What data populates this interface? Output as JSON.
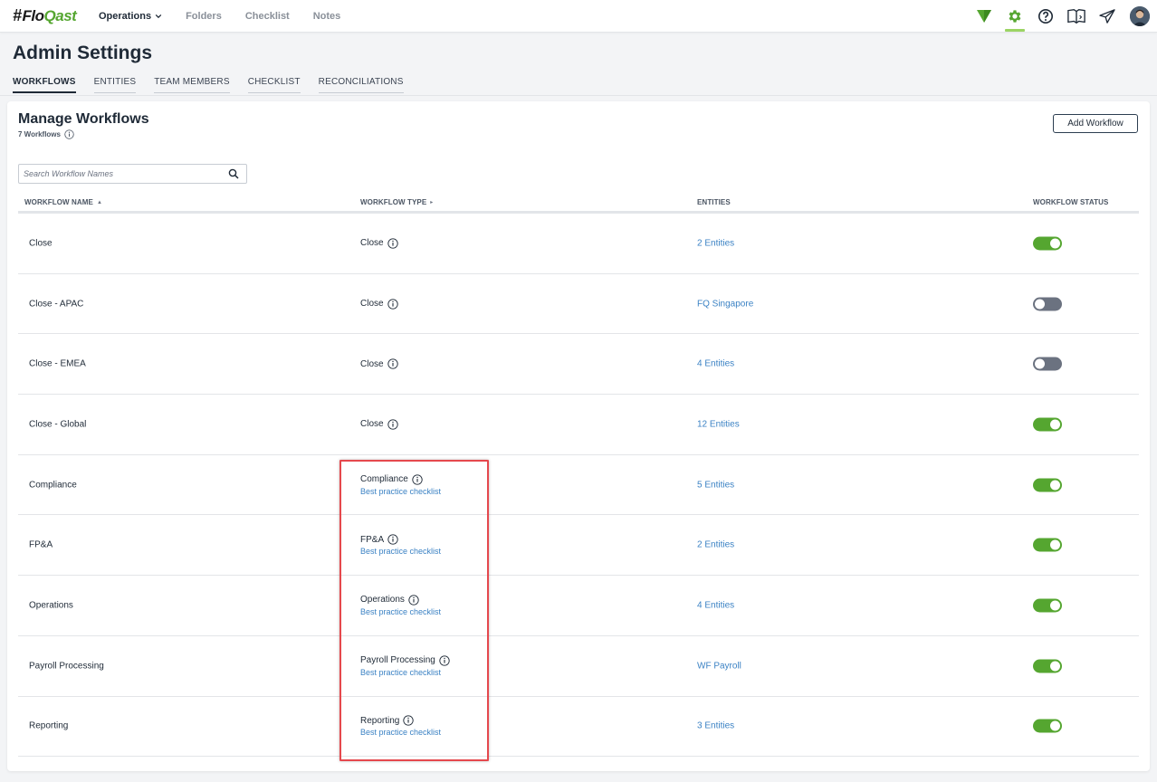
{
  "app": {
    "logo_hash": "#",
    "logo_text_a": "Flo",
    "logo_text_b": "Qast"
  },
  "nav": {
    "items": [
      {
        "label": "Operations"
      },
      {
        "label": "Folders"
      },
      {
        "label": "Checklist"
      },
      {
        "label": "Notes"
      }
    ]
  },
  "page": {
    "title": "Admin Settings",
    "tabs": [
      {
        "label": "WORKFLOWS"
      },
      {
        "label": "ENTITIES"
      },
      {
        "label": "TEAM MEMBERS"
      },
      {
        "label": "CHECKLIST"
      },
      {
        "label": "RECONCILIATIONS"
      }
    ]
  },
  "card": {
    "title": "Manage Workflows",
    "count": "7 Workflows",
    "add_button": "Add Workflow",
    "search_placeholder": "Search Workflow Names"
  },
  "table": {
    "columns": [
      {
        "label": "WORKFLOW NAME",
        "sort": "▲"
      },
      {
        "label": "WORKFLOW TYPE",
        "sort": "▸"
      },
      {
        "label": "ENTITIES"
      },
      {
        "label": "WORKFLOW STATUS"
      }
    ],
    "rows": [
      {
        "name": "Close",
        "type": "Close",
        "checklist": "",
        "entities": "2 Entities",
        "status": "on"
      },
      {
        "name": "Close - APAC",
        "type": "Close",
        "checklist": "",
        "entities": "FQ Singapore",
        "status": "off"
      },
      {
        "name": "Close - EMEA",
        "type": "Close",
        "checklist": "",
        "entities": "4 Entities",
        "status": "off"
      },
      {
        "name": "Close - Global",
        "type": "Close",
        "checklist": "",
        "entities": "12 Entities",
        "status": "on"
      },
      {
        "name": "Compliance",
        "type": "Compliance",
        "checklist": "Best practice checklist",
        "entities": "5 Entities",
        "status": "on"
      },
      {
        "name": "FP&A",
        "type": "FP&A",
        "checklist": "Best practice checklist",
        "entities": "2 Entities",
        "status": "on"
      },
      {
        "name": "Operations",
        "type": "Operations",
        "checklist": "Best practice checklist",
        "entities": "4 Entities",
        "status": "on"
      },
      {
        "name": "Payroll Processing",
        "type": "Payroll Processing",
        "checklist": "Best practice checklist",
        "entities": "WF Payroll",
        "status": "on"
      },
      {
        "name": "Reporting",
        "type": "Reporting",
        "checklist": "Best practice checklist",
        "entities": "3 Entities",
        "status": "on"
      }
    ]
  },
  "colors": {
    "accent_green": "#55a630",
    "link_blue": "#3b82c4",
    "toggle_off": "#6b7280",
    "highlight_red": "#e5484d"
  }
}
